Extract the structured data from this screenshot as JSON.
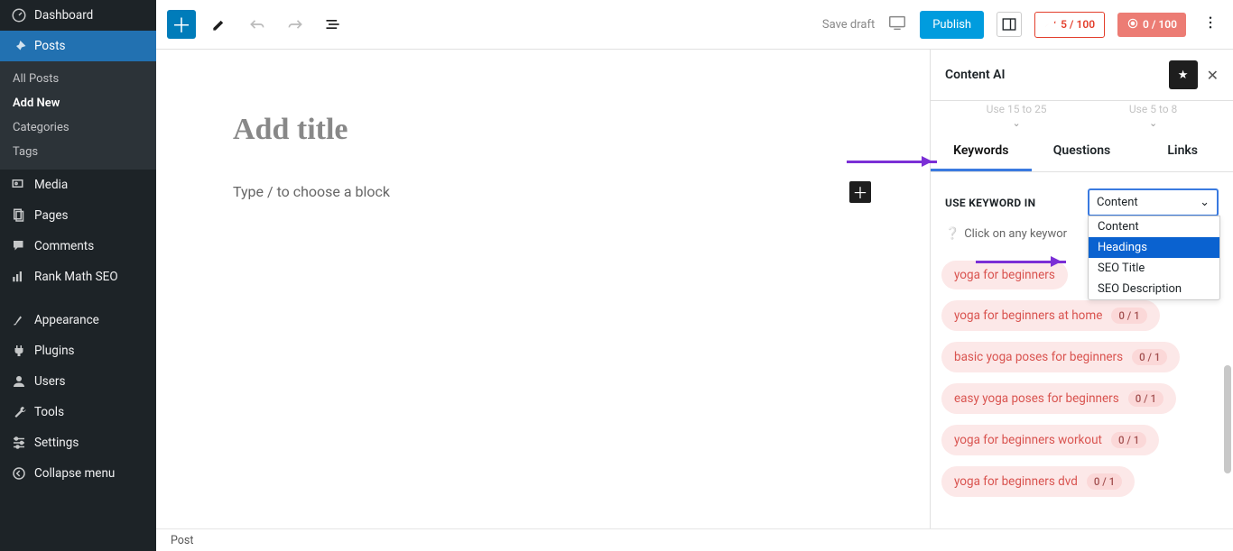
{
  "sidebar": {
    "dashboard": "Dashboard",
    "posts": "Posts",
    "posts_sub": {
      "all_posts": "All Posts",
      "add_new": "Add New",
      "categories": "Categories",
      "tags": "Tags"
    },
    "media": "Media",
    "pages": "Pages",
    "comments": "Comments",
    "rank_math": "Rank Math SEO",
    "appearance": "Appearance",
    "plugins": "Plugins",
    "users": "Users",
    "tools": "Tools",
    "settings": "Settings",
    "collapse": "Collapse menu"
  },
  "toolbar": {
    "save_draft": "Save draft",
    "publish": "Publish",
    "score1": "5 / 100",
    "score2": "0 / 100"
  },
  "editor": {
    "title_placeholder": "Add title",
    "block_placeholder": "Type / to choose a block"
  },
  "panel": {
    "title": "Content AI",
    "hint1": "Use 15 to 25",
    "hint2": "Use 5 to 8",
    "tabs": {
      "keywords": "Keywords",
      "questions": "Questions",
      "links": "Links"
    },
    "use_keyword_label": "USE KEYWORD IN",
    "select_value": "Content",
    "options": {
      "content": "Content",
      "headings": "Headings",
      "seo_title": "SEO Title",
      "seo_description": "SEO Description"
    },
    "click_hint": "Click on any keywor",
    "keywords": [
      {
        "text": "yoga for beginners"
      },
      {
        "text": "yoga for beginners at home",
        "count": "0 / 1"
      },
      {
        "text": "basic yoga poses for beginners",
        "count": "0 / 1"
      },
      {
        "text": "easy yoga poses for beginners",
        "count": "0 / 1"
      },
      {
        "text": "yoga for beginners workout",
        "count": "0 / 1"
      },
      {
        "text": "yoga for beginners dvd",
        "count": "0 / 1"
      }
    ]
  },
  "bottom": {
    "breadcrumb": "Post"
  }
}
